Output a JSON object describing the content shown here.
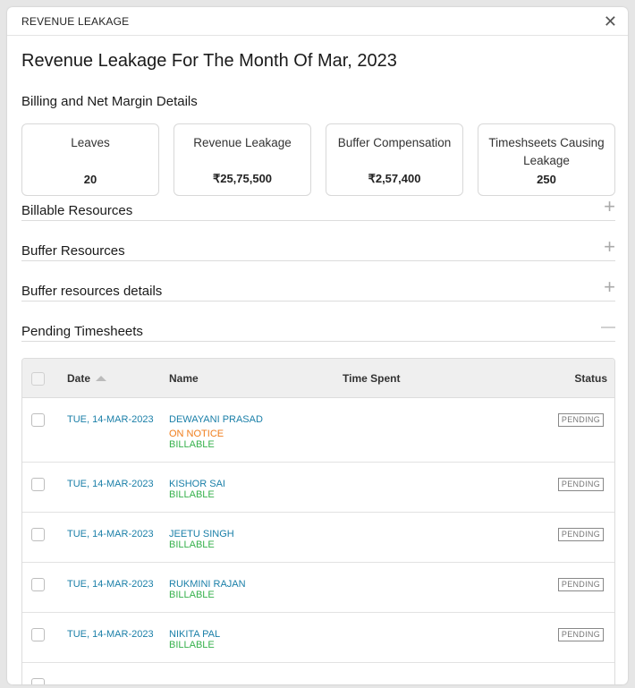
{
  "header": {
    "title": "REVENUE LEAKAGE",
    "close": "✕"
  },
  "page_title": "Revenue Leakage For The Month Of Mar, 2023",
  "billing_heading": "Billing and Net Margin Details",
  "cards": [
    {
      "label": "Leaves",
      "value": "20"
    },
    {
      "label": "Revenue Leakage",
      "value": "₹25,75,500"
    },
    {
      "label": "Buffer Compensation",
      "value": "₹2,57,400"
    },
    {
      "label": "Timeshseets Causing Leakage",
      "value": "250"
    }
  ],
  "accordions": [
    {
      "label": "Billable Resources",
      "icon": "+",
      "icon_name": "plus-icon"
    },
    {
      "label": "Buffer Resources",
      "icon": "+",
      "icon_name": "plus-icon"
    },
    {
      "label": "Buffer resources details",
      "icon": "+",
      "icon_name": "plus-icon"
    },
    {
      "label": "Pending Timesheets",
      "icon": "—",
      "icon_name": "minus-icon"
    }
  ],
  "table": {
    "columns": {
      "date": "Date",
      "name": "Name",
      "time_spent": "Time Spent",
      "status": "Status"
    },
    "rows": [
      {
        "date": "TUE, 14-MAR-2023",
        "name": "DEWAYANI PRASAD",
        "notice": "ON NOTICE",
        "billable": "BILLABLE",
        "status": "PENDING"
      },
      {
        "date": "TUE, 14-MAR-2023",
        "name": "KISHOR SAI",
        "billable": "BILLABLE",
        "status": "PENDING"
      },
      {
        "date": "TUE, 14-MAR-2023",
        "name": "JEETU SINGH",
        "billable": "BILLABLE",
        "status": "PENDING"
      },
      {
        "date": "TUE, 14-MAR-2023",
        "name": "RUKMINI RAJAN",
        "billable": "BILLABLE",
        "status": "PENDING"
      },
      {
        "date": "TUE, 14-MAR-2023",
        "name": "NIKITA PAL",
        "billable": "BILLABLE",
        "status": "PENDING"
      }
    ]
  }
}
